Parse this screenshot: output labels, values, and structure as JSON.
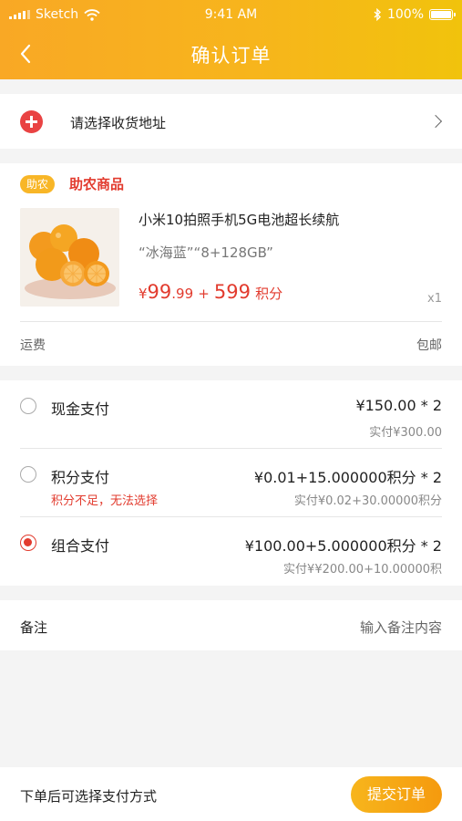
{
  "status_bar": {
    "carrier": "Sketch",
    "time": "9:41 AM",
    "battery": "100%"
  },
  "nav": {
    "title": "确认订单"
  },
  "address": {
    "label": "请选择收货地址"
  },
  "goods": {
    "tag": "助农",
    "category": "助农商品",
    "name": "小米10拍照手机5G电池超长续航",
    "spec": "“冰海蓝”“8+128GB”",
    "price_symbol": "¥",
    "price_int": "99",
    "price_dec": ".99",
    "plus": "+",
    "points": "599",
    "points_unit": "积分",
    "qty": "x1",
    "shipping_label": "运费",
    "shipping_value": "包邮"
  },
  "payment": {
    "selected": 2,
    "options": [
      {
        "label": "现金支付",
        "amount": "¥150.00 * 2",
        "actual": "实付¥300.00",
        "warning": ""
      },
      {
        "label": "积分支付",
        "amount": "¥0.01+15.000000积分 * 2",
        "actual": "实付¥0.02+30.00000积分",
        "warning": "积分不足，无法选择"
      },
      {
        "label": "组合支付",
        "amount": "¥100.00+5.000000积分 * 2",
        "actual": "实付¥¥200.00+10.00000积",
        "warning": ""
      }
    ]
  },
  "memo": {
    "label": "备注",
    "placeholder": "输入备注内容"
  },
  "footer": {
    "hint": "下单后可选择支付方式",
    "submit_label": "提交订单"
  },
  "colors": {
    "accent": "#f7b51c",
    "price_red": "#e23b2e",
    "add_icon": "#e94343"
  }
}
